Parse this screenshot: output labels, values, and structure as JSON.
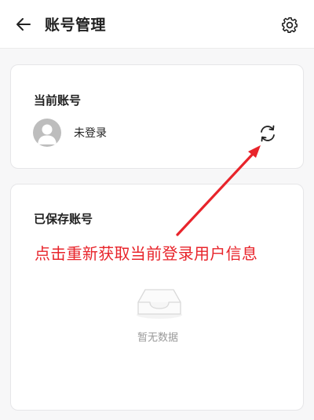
{
  "header": {
    "title": "账号管理",
    "back_icon": "arrow-left-icon",
    "settings_icon": "gear-icon"
  },
  "current_account": {
    "heading": "当前账号",
    "name": "未登录",
    "avatar_icon": "user-avatar-icon",
    "refresh_icon": "refresh-icon"
  },
  "saved_accounts": {
    "heading": "已保存账号",
    "empty_text": "暂无数据",
    "empty_icon": "empty-inbox-icon"
  },
  "annotation": {
    "text": "点击重新获取当前登录用户信息",
    "color": "#e8242b"
  },
  "colors": {
    "background": "#f7f7f8",
    "card": "#ffffff",
    "text_primary": "#222222",
    "text_muted": "#999999"
  }
}
